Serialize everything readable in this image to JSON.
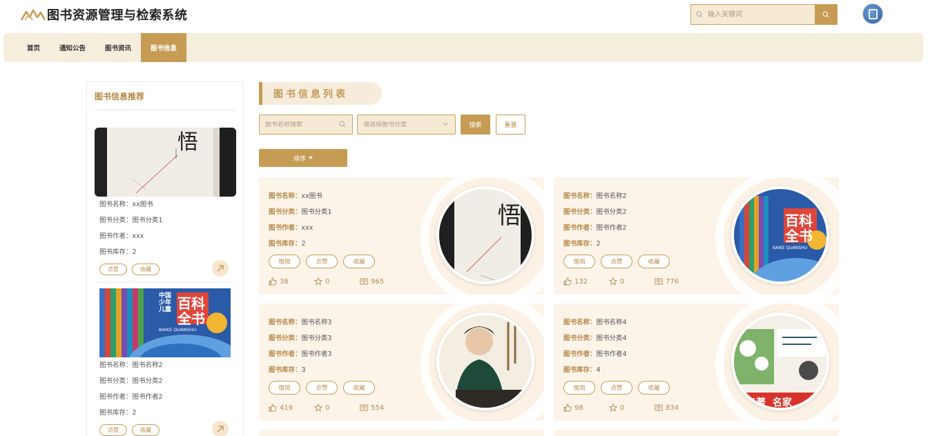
{
  "app": {
    "title": "图书资源管理与检索系统"
  },
  "header": {
    "search_placeholder": "输入关键词"
  },
  "nav": {
    "items": [
      "首页",
      "通知公告",
      "图书资讯",
      "图书信息"
    ],
    "active": "图书信息"
  },
  "colors": {
    "accent": "#c69b53",
    "nav_bg": "#f6eedd",
    "card_bg": "#fcf4e9",
    "title_gold": "#b4873f"
  },
  "sidebar": {
    "title": "图书信息推荐",
    "items": [
      {
        "name": "图书名称：xx图书",
        "category": "图书分类：图书分类1",
        "author": "图书作者：xxx",
        "stock": "图书库存：2",
        "like": "点赞",
        "collect": "收藏"
      },
      {
        "name": "图书名称：图书名称2",
        "category": "图书分类：图书分类2",
        "author": "图书作者：图书作者2",
        "stock": "图书库存：2",
        "like": "点赞",
        "collect": "收藏"
      }
    ]
  },
  "main": {
    "list_title": "图书信息列表",
    "name_placeholder": "图书名称搜索",
    "category_placeholder": "请选择图书分类",
    "search_label": "搜索",
    "reset_label": "重置",
    "sort_label": "排序",
    "field_labels": {
      "name": "图书名称：",
      "category": "图书分类：",
      "author": "图书作者：",
      "stock": "图书库存："
    },
    "action_labels": {
      "borrow": "借阅",
      "like": "点赞",
      "collect": "收藏"
    },
    "cards": [
      {
        "name": "xx图书",
        "category": "图书分类1",
        "author": "xxx",
        "stock": "2",
        "likes": "38",
        "stars": "0",
        "views": "965"
      },
      {
        "name": "图书名称2",
        "category": "图书分类2",
        "author": "图书作者2",
        "stock": "2",
        "likes": "132",
        "stars": "0",
        "views": "776"
      },
      {
        "name": "图书名称3",
        "category": "图书分类3",
        "author": "图书作者3",
        "stock": "3",
        "likes": "419",
        "stars": "0",
        "views": "554"
      },
      {
        "name": "图书名称4",
        "category": "图书分类4",
        "author": "图书作者4",
        "stock": "4",
        "likes": "98",
        "stars": "0",
        "views": "834"
      }
    ]
  },
  "book_covers": {
    "cover1_title": "悟",
    "cover2_title_lines": [
      "百科",
      "全书"
    ],
    "cover2_sub": "中国少年儿童",
    "cover2_pinyin": "BAIKE QUANSHU",
    "cover4_bottom": "名著  名家"
  }
}
